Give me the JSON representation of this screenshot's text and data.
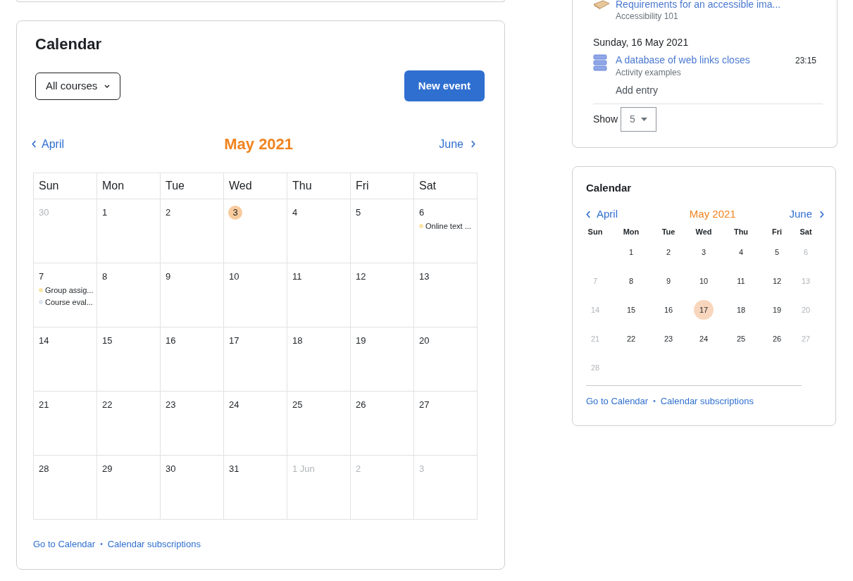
{
  "upcoming": {
    "items": [
      {
        "title": "Requirements for an accessible ima...",
        "course": "Accessibility 101",
        "kind": "book"
      }
    ],
    "day_groups": [
      {
        "date": "Sunday, 16 May 2021",
        "items": [
          {
            "title": "A database of web links closes",
            "course": "Activity examples",
            "time": "23:15",
            "kind": "database",
            "action": "Add entry"
          }
        ]
      }
    ],
    "show_label": "Show",
    "show_value": "5"
  },
  "calendar": {
    "title": "Calendar",
    "course_filter": "All courses",
    "new_event": "New event",
    "prev": "April",
    "month": "May 2021",
    "next": "June",
    "weekdays": [
      "Sun",
      "Mon",
      "Tue",
      "Wed",
      "Thu",
      "Fri",
      "Sat"
    ],
    "weeks": [
      [
        {
          "label": "30",
          "other_month": true,
          "today": false
        },
        {
          "label": "1",
          "other_month": false,
          "today": false
        },
        {
          "label": "2",
          "other_month": false,
          "today": false
        },
        {
          "label": "3",
          "other_month": false,
          "today": true
        },
        {
          "label": "4",
          "other_month": false,
          "today": false
        },
        {
          "label": "5",
          "other_month": false,
          "today": false
        },
        {
          "label": "6",
          "other_month": false,
          "today": false,
          "events": [
            {
              "name": "Online text ...",
              "color": "#fbe5a8"
            }
          ]
        }
      ],
      [
        {
          "label": "7",
          "other_month": false,
          "today": false,
          "events": [
            {
              "name": "Group assig...",
              "color": "#fbe5a8"
            },
            {
              "name": "Course eval...",
              "color": "#dde6ef"
            }
          ]
        },
        {
          "label": "8",
          "other_month": false,
          "today": false
        },
        {
          "label": "9",
          "other_month": false,
          "today": false
        },
        {
          "label": "10",
          "other_month": false,
          "today": false
        },
        {
          "label": "11",
          "other_month": false,
          "today": false
        },
        {
          "label": "12",
          "other_month": false,
          "today": false
        },
        {
          "label": "13",
          "other_month": false,
          "today": false
        }
      ],
      [
        {
          "label": "14",
          "other_month": false,
          "today": false
        },
        {
          "label": "15",
          "other_month": false,
          "today": false
        },
        {
          "label": "16",
          "other_month": false,
          "today": false
        },
        {
          "label": "17",
          "other_month": false,
          "today": false
        },
        {
          "label": "18",
          "other_month": false,
          "today": false
        },
        {
          "label": "19",
          "other_month": false,
          "today": false
        },
        {
          "label": "20",
          "other_month": false,
          "today": false
        }
      ],
      [
        {
          "label": "21",
          "other_month": false,
          "today": false
        },
        {
          "label": "22",
          "other_month": false,
          "today": false
        },
        {
          "label": "23",
          "other_month": false,
          "today": false
        },
        {
          "label": "24",
          "other_month": false,
          "today": false
        },
        {
          "label": "25",
          "other_month": false,
          "today": false
        },
        {
          "label": "26",
          "other_month": false,
          "today": false
        },
        {
          "label": "27",
          "other_month": false,
          "today": false
        }
      ],
      [
        {
          "label": "28",
          "other_month": false,
          "today": false
        },
        {
          "label": "29",
          "other_month": false,
          "today": false
        },
        {
          "label": "30",
          "other_month": false,
          "today": false
        },
        {
          "label": "31",
          "other_month": false,
          "today": false
        },
        {
          "label": "1 Jun",
          "other_month": true,
          "today": false
        },
        {
          "label": "2",
          "other_month": true,
          "today": false
        },
        {
          "label": "3",
          "other_month": true,
          "today": false
        }
      ]
    ],
    "links": [
      "Go to Calendar",
      "Calendar subscriptions"
    ],
    "link_separator": "•"
  },
  "mini_calendar": {
    "title": "Calendar",
    "prev": "April",
    "month": "May 2021",
    "next": "June",
    "weekdays": [
      "Sun",
      "Mon",
      "Tue",
      "Wed",
      "Thu",
      "Fri",
      "Sat"
    ],
    "weeks": [
      [
        {
          "label": "1",
          "muted": false,
          "today": false
        },
        {
          "label": "2",
          "muted": false,
          "today": false
        },
        {
          "label": "3",
          "muted": false,
          "today": false
        },
        {
          "label": "4",
          "muted": false,
          "today": false
        },
        {
          "label": "5",
          "muted": false,
          "today": false
        },
        {
          "label": "6",
          "muted": true,
          "today": false
        }
      ],
      [
        {
          "label": "7",
          "muted": true,
          "today": false
        },
        {
          "label": "8",
          "muted": false,
          "today": false
        },
        {
          "label": "9",
          "muted": false,
          "today": false
        },
        {
          "label": "10",
          "muted": false,
          "today": false
        },
        {
          "label": "11",
          "muted": false,
          "today": false
        },
        {
          "label": "12",
          "muted": false,
          "today": false
        },
        {
          "label": "13",
          "muted": true,
          "today": false
        }
      ],
      [
        {
          "label": "14",
          "muted": true,
          "today": false
        },
        {
          "label": "15",
          "muted": false,
          "today": false
        },
        {
          "label": "16",
          "muted": false,
          "today": false
        },
        {
          "label": "17",
          "muted": false,
          "today": true
        },
        {
          "label": "18",
          "muted": false,
          "today": false
        },
        {
          "label": "19",
          "muted": false,
          "today": false
        },
        {
          "label": "20",
          "muted": true,
          "today": false
        }
      ],
      [
        {
          "label": "21",
          "muted": true,
          "today": false
        },
        {
          "label": "22",
          "muted": false,
          "today": false
        },
        {
          "label": "23",
          "muted": false,
          "today": false
        },
        {
          "label": "24",
          "muted": false,
          "today": false
        },
        {
          "label": "25",
          "muted": false,
          "today": false
        },
        {
          "label": "26",
          "muted": false,
          "today": false
        },
        {
          "label": "27",
          "muted": true,
          "today": false
        }
      ],
      [
        {
          "label": "28",
          "muted": true,
          "today": false
        }
      ]
    ],
    "links": [
      "Go to Calendar",
      "Calendar subscriptions"
    ],
    "link_separator": "•"
  }
}
